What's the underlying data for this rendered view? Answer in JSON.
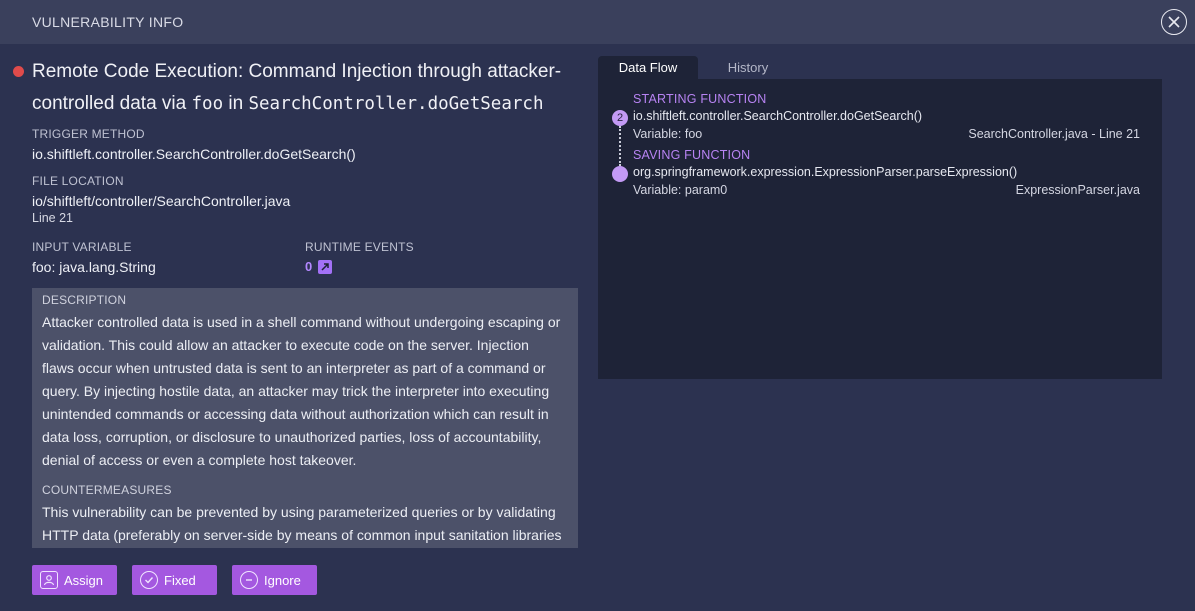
{
  "header": {
    "title": "VULNERABILITY INFO",
    "close_icon": "close-icon"
  },
  "vulnerability": {
    "severity_color": "#e04b4b",
    "title_prefix": "Remote Code Execution: Command Injection through attacker-controlled data via ",
    "title_code1": "foo",
    "title_mid": " in ",
    "title_code2": "SearchController.doGetSearch"
  },
  "trigger_method": {
    "label": "TRIGGER METHOD",
    "value": "io.shiftleft.controller.SearchController.doGetSearch()"
  },
  "file_location": {
    "label": "FILE LOCATION",
    "path": "io/shiftleft/controller/SearchController.java",
    "line": "Line 21"
  },
  "input_variable": {
    "label": "INPUT VARIABLE",
    "value": "foo: java.lang.String"
  },
  "runtime_events": {
    "label": "RUNTIME EVENTS",
    "count": "0",
    "icon": "external-link-icon"
  },
  "description": {
    "label": "DESCRIPTION",
    "text": "Attacker controlled data is used in a shell command without undergoing escaping or validation. This could allow an attacker to execute code on the server. Injection flaws occur when untrusted data is sent to an interpreter as part of a command or query. By injecting hostile data, an attacker may trick the interpreter into executing unintended commands or accessing data without authorization which can result in data loss, corruption, or disclosure to unauthorized parties, loss of accountability, denial of access or even a complete host takeover.",
    "countermeasures_label": "COUNTERMEASURES",
    "countermeasures_text": "This vulnerability can be prevented by using parameterized queries or by validating HTTP data (preferably on server-side by means of common input sanitation libraries"
  },
  "actions": {
    "assign": {
      "label": "Assign",
      "icon": "user-icon"
    },
    "fixed": {
      "label": "Fixed",
      "icon": "check-icon"
    },
    "ignore": {
      "label": "Ignore",
      "icon": "minus-circle-icon"
    },
    "color": "#a458e0"
  },
  "tabs": [
    {
      "label": "Data Flow",
      "active": true
    },
    {
      "label": "History",
      "active": false
    }
  ],
  "data_flow": {
    "step_count": "2",
    "start": {
      "label": "STARTING FUNCTION",
      "function": "io.shiftleft.controller.SearchController.doGetSearch()",
      "variable": "Variable: foo",
      "file": "SearchController.java - Line 21"
    },
    "save": {
      "label": "SAVING FUNCTION",
      "function": "org.springframework.expression.ExpressionParser.parseExpression()",
      "variable": "Variable: param0",
      "file": "ExpressionParser.java"
    }
  }
}
